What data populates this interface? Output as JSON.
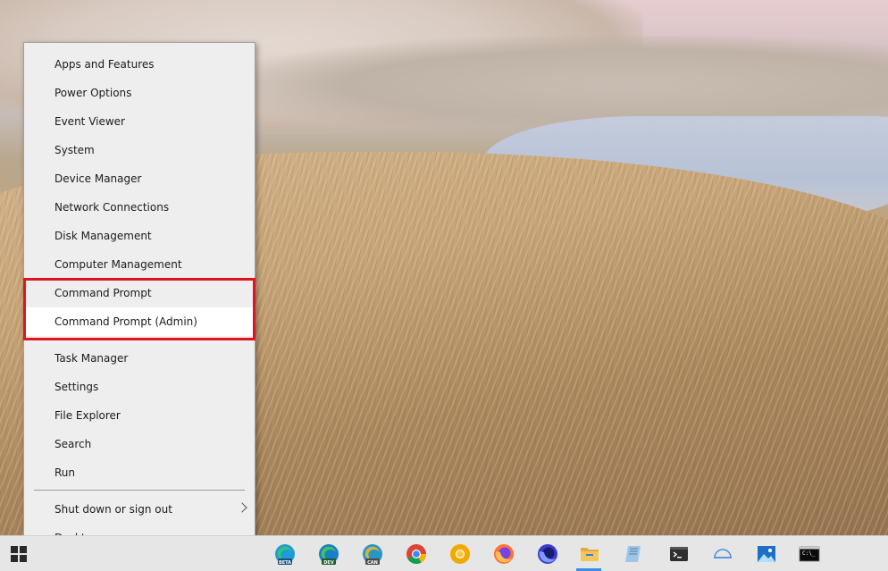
{
  "menu": {
    "items": [
      {
        "label": "Apps and Features"
      },
      {
        "label": "Power Options"
      },
      {
        "label": "Event Viewer"
      },
      {
        "label": "System"
      },
      {
        "label": "Device Manager"
      },
      {
        "label": "Network Connections"
      },
      {
        "label": "Disk Management"
      },
      {
        "label": "Computer Management"
      },
      {
        "label": "Command Prompt"
      },
      {
        "label": "Command Prompt (Admin)"
      },
      {
        "label": "Task Manager"
      },
      {
        "label": "Settings"
      },
      {
        "label": "File Explorer"
      },
      {
        "label": "Search"
      },
      {
        "label": "Run"
      },
      {
        "label": "Shut down or sign out"
      },
      {
        "label": "Desktop"
      }
    ],
    "highlight_color": "#e0141e"
  },
  "taskbar": {
    "icons": [
      {
        "name": "windows-start-icon"
      },
      {
        "name": "edge-beta-icon",
        "badge": "BETA"
      },
      {
        "name": "edge-dev-icon",
        "badge": "DEV"
      },
      {
        "name": "edge-canary-icon",
        "badge": "CAN"
      },
      {
        "name": "chrome-icon"
      },
      {
        "name": "chrome-canary-icon"
      },
      {
        "name": "firefox-icon"
      },
      {
        "name": "firefox-nightly-icon"
      },
      {
        "name": "file-explorer-icon"
      },
      {
        "name": "notepad-icon"
      },
      {
        "name": "terminal-icon"
      },
      {
        "name": "snip-icon"
      },
      {
        "name": "photos-icon"
      },
      {
        "name": "command-prompt-icon"
      }
    ],
    "accent": "#3c8de6"
  }
}
